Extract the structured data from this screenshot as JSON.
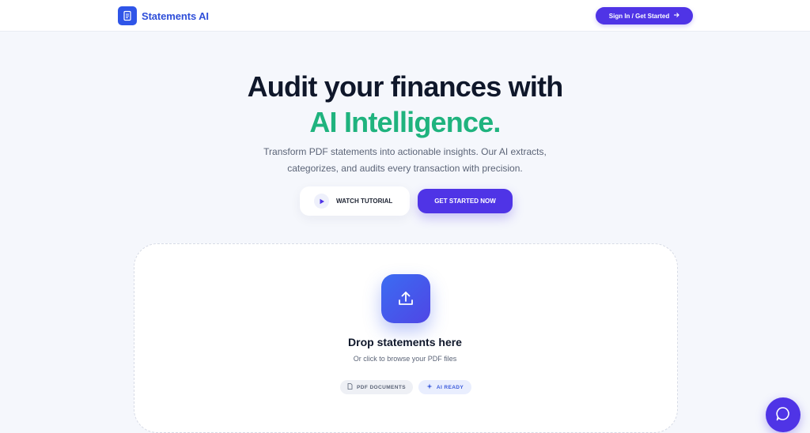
{
  "nav": {
    "brand_name": "Statements AI",
    "brand_icon": "document-icon",
    "signin_label": "Sign In / Get Started",
    "signin_icon": "arrow-right-icon"
  },
  "hero": {
    "title_line1": "Audit your finances with",
    "title_line2": "AI Intelligence.",
    "subtitle_line1": "Transform PDF statements into actionable insights. Our AI extracts,",
    "subtitle_line2": "categorizes, and audits every transaction with precision.",
    "watch_label": "WATCH TUTORIAL",
    "watch_icon": "play-icon",
    "start_label": "GET STARTED NOW"
  },
  "dropzone": {
    "icon": "upload-icon",
    "title": "Drop statements here",
    "subtitle": "Or click to browse your PDF files",
    "pills": [
      {
        "label": "PDF DOCUMENTS",
        "icon": "file-icon"
      },
      {
        "label": "AI READY",
        "icon": "sparkle-icon"
      }
    ]
  },
  "chat": {
    "icon": "chat-bubble-icon"
  },
  "colors": {
    "accent": "#4f34e6",
    "brand_blue": "#2f55e8",
    "highlight_green": "#1fb37e",
    "background": "#f5f7fc"
  }
}
